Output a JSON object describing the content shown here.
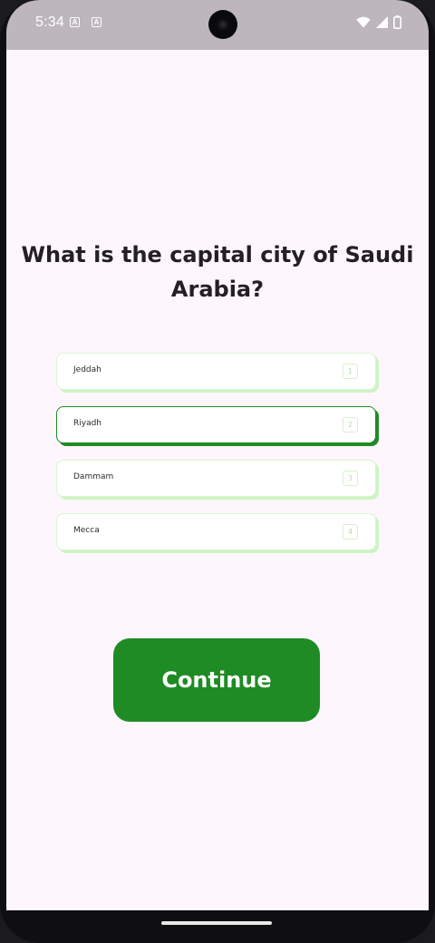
{
  "status_bar": {
    "time": "5:34",
    "notifications": [
      {
        "icon": "app-notification-icon",
        "glyph": "A"
      },
      {
        "icon": "app-notification-icon",
        "glyph": "A"
      }
    ],
    "right_icons": [
      "wifi-icon",
      "signal-icon",
      "battery-icon"
    ]
  },
  "quiz": {
    "question": "What is the capital city of Saudi Arabia?",
    "options": [
      {
        "label": "Jeddah",
        "key": "1",
        "selected": false
      },
      {
        "label": "Riyadh",
        "key": "2",
        "selected": true
      },
      {
        "label": "Dammam",
        "key": "3",
        "selected": false
      },
      {
        "label": "Mecca",
        "key": "4",
        "selected": false
      }
    ],
    "continue_label": "Continue"
  },
  "colors": {
    "accent": "#1f8b24",
    "option_border": "#d7f7cf",
    "background": "#fdf6fd",
    "status_bar": "#bdb7bd"
  }
}
